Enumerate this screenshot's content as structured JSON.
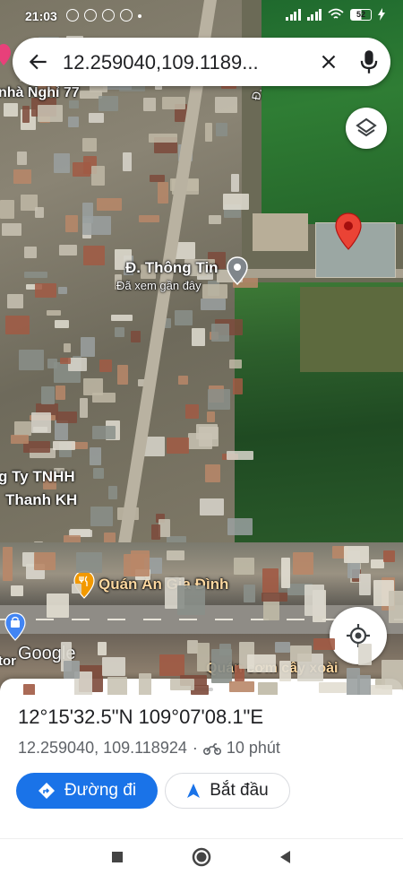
{
  "status_bar": {
    "time": "21:03",
    "battery": "52"
  },
  "search": {
    "query": "12.259040,109.1189..."
  },
  "map": {
    "labels": {
      "nha_nghi": "nhà Nghỉ 77",
      "road_thong_tin_vertical": "Đ. Thông Ti",
      "place_thong_tin": "Đ. Thông Tin",
      "place_thong_tin_sub": "Đã xem gần đây",
      "company_line1": "g Ty TNHH",
      "company_line2": "Thanh KH",
      "restaurant_gia_dinh": "Quán Ăn Gia Đình",
      "store_partial": "tor",
      "restaurant_com": "Quán cơm cây xoài",
      "google": "Google"
    },
    "colors": {
      "pin_red": "#ea4335",
      "poi_orange": "#f29900",
      "poi_blue": "#4285f4",
      "visited_pin": "#80868b"
    }
  },
  "place_sheet": {
    "coordinates_dms": "12°15'32.5\"N 109°07'08.1\"E",
    "coordinates_decimal": "12.259040, 109.118924",
    "separator": "·",
    "travel_time": "10 phút",
    "directions_label": "Đường đi",
    "start_label": "Bắt đầu",
    "accent_color": "#1a73e8"
  },
  "nav_bar": {
    "icons": [
      "recents-square-icon",
      "home-circle-icon",
      "back-triangle-icon"
    ]
  }
}
